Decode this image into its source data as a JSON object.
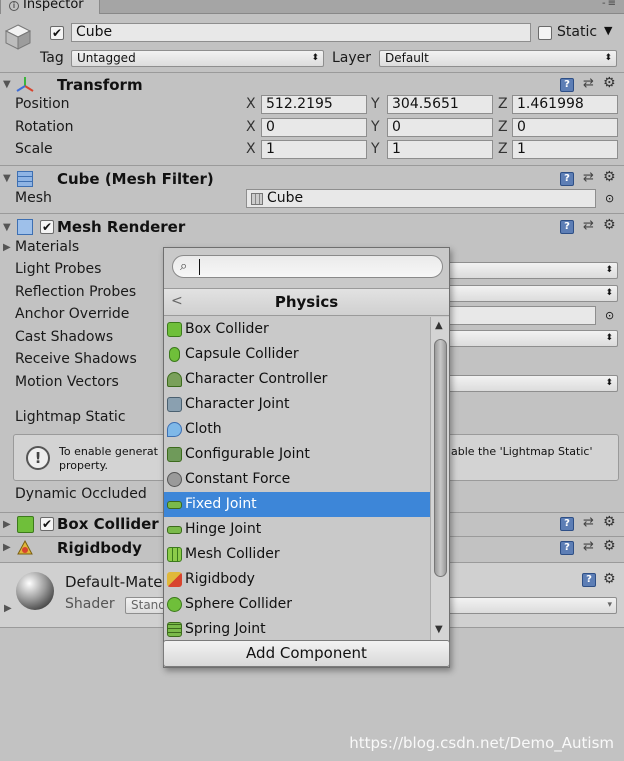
{
  "inspector_tab": {
    "label": "Inspector",
    "icon": "info-icon",
    "menu": "-≡"
  },
  "object": {
    "name": "Cube",
    "static_label": "Static",
    "tag_label": "Tag",
    "tag_value": "Untagged",
    "layer_label": "Layer",
    "layer_value": "Default"
  },
  "transform": {
    "title": "Transform",
    "rows": [
      {
        "label": "Position",
        "x": "512.2195",
        "y": "304.5651",
        "z": "1.461998"
      },
      {
        "label": "Rotation",
        "x": "0",
        "y": "0",
        "z": "0"
      },
      {
        "label": "Scale",
        "x": "1",
        "y": "1",
        "z": "1"
      }
    ],
    "axis_x": "X",
    "axis_y": "Y",
    "axis_z": "Z"
  },
  "mesh_filter": {
    "title": "Cube (Mesh Filter)",
    "mesh_label": "Mesh",
    "mesh_value": "Cube"
  },
  "mesh_renderer": {
    "title": "Mesh Renderer",
    "labels": [
      "Materials",
      "Light Probes",
      "Reflection Probes",
      "Anchor Override",
      "Cast Shadows",
      "Receive Shadows",
      "Motion Vectors",
      "Lightmap Static",
      "Dynamic Occluded"
    ],
    "info_left": "To enable generat",
    "info_left2": "property.",
    "info_right": "able the 'Lightmap Static'"
  },
  "components": {
    "box_collider": "Box Collider",
    "rigidbody": "Rigidbody"
  },
  "material": {
    "name": "Default-Mater",
    "shader_label": "Shader",
    "shader_value": "Stand"
  },
  "popup": {
    "search_value": "",
    "header": "Physics",
    "back": "<",
    "items": [
      "Box Collider",
      "Capsule Collider",
      "Character Controller",
      "Character Joint",
      "Cloth",
      "Configurable Joint",
      "Constant Force",
      "Fixed Joint",
      "Hinge Joint",
      "Mesh Collider",
      "Rigidbody",
      "Sphere Collider",
      "Spring Joint"
    ],
    "selected": "Fixed Joint",
    "add_component": "Add Component"
  },
  "watermark": "https://blog.csdn.net/Demo_Autism",
  "colors": {
    "selection": "#3d86d8",
    "panel": "#c2c2c2",
    "help": "#5d7eb5"
  }
}
